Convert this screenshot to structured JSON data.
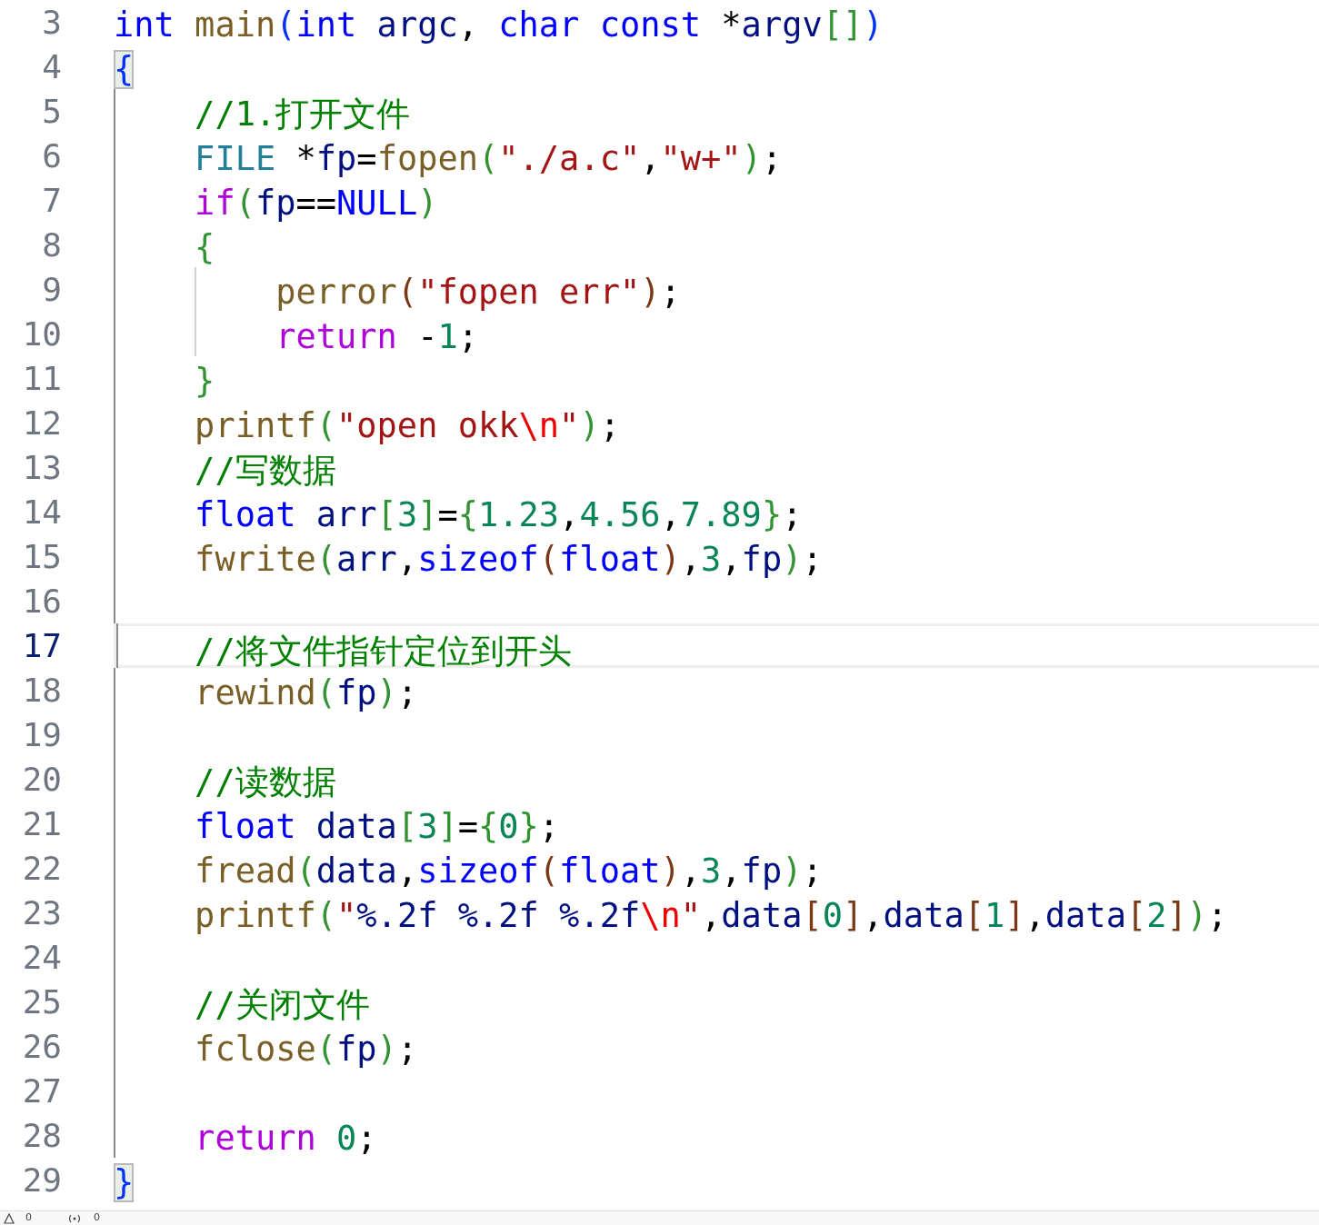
{
  "editor": {
    "lines": [
      {
        "number": "3",
        "current": false,
        "guide": false,
        "inner_guide": false,
        "tokens": [
          {
            "kind": "kw",
            "text": "int"
          },
          {
            "kind": "fn",
            "text": " main"
          },
          {
            "kind": "b1",
            "text": "("
          },
          {
            "kind": "kw",
            "text": "int"
          },
          {
            "kind": "var",
            "text": " argc"
          },
          {
            "kind": "op",
            "text": ", "
          },
          {
            "kind": "kw",
            "text": "char"
          },
          {
            "kind": "kw",
            "text": " const"
          },
          {
            "kind": "op",
            "text": " *"
          },
          {
            "kind": "var",
            "text": "argv"
          },
          {
            "kind": "b2",
            "text": "[]"
          },
          {
            "kind": "b1",
            "text": ")"
          }
        ]
      },
      {
        "number": "4",
        "current": false,
        "guide": false,
        "inner_guide": false,
        "tokens": [
          {
            "kind": "match",
            "text": "{"
          }
        ]
      },
      {
        "number": "5",
        "current": false,
        "guide": true,
        "inner_guide": false,
        "tokens": [
          {
            "kind": "cmt",
            "text": "    //1.打开文件"
          }
        ]
      },
      {
        "number": "6",
        "current": false,
        "guide": true,
        "inner_guide": false,
        "tokens": [
          {
            "kind": "type",
            "text": "    FILE"
          },
          {
            "kind": "op",
            "text": " *"
          },
          {
            "kind": "var",
            "text": "fp"
          },
          {
            "kind": "op",
            "text": "="
          },
          {
            "kind": "fn",
            "text": "fopen"
          },
          {
            "kind": "b2",
            "text": "("
          },
          {
            "kind": "str",
            "text": "\"./a.c\""
          },
          {
            "kind": "op",
            "text": ","
          },
          {
            "kind": "str",
            "text": "\"w+\""
          },
          {
            "kind": "b2",
            "text": ")"
          },
          {
            "kind": "op",
            "text": ";"
          }
        ]
      },
      {
        "number": "7",
        "current": false,
        "guide": true,
        "inner_guide": false,
        "tokens": [
          {
            "kind": "ctl",
            "text": "    if"
          },
          {
            "kind": "b2",
            "text": "("
          },
          {
            "kind": "var",
            "text": "fp"
          },
          {
            "kind": "op",
            "text": "=="
          },
          {
            "kind": "kw",
            "text": "NULL"
          },
          {
            "kind": "b2",
            "text": ")"
          }
        ]
      },
      {
        "number": "8",
        "current": false,
        "guide": true,
        "inner_guide": false,
        "tokens": [
          {
            "kind": "b2",
            "text": "    {"
          }
        ]
      },
      {
        "number": "9",
        "current": false,
        "guide": true,
        "inner_guide": true,
        "tokens": [
          {
            "kind": "fn",
            "text": "        perror"
          },
          {
            "kind": "b3",
            "text": "("
          },
          {
            "kind": "str",
            "text": "\"fopen err\""
          },
          {
            "kind": "b3",
            "text": ")"
          },
          {
            "kind": "op",
            "text": ";"
          }
        ]
      },
      {
        "number": "10",
        "current": false,
        "guide": true,
        "inner_guide": true,
        "tokens": [
          {
            "kind": "ctl",
            "text": "        return"
          },
          {
            "kind": "op",
            "text": " -"
          },
          {
            "kind": "num",
            "text": "1"
          },
          {
            "kind": "op",
            "text": ";"
          }
        ]
      },
      {
        "number": "11",
        "current": false,
        "guide": true,
        "inner_guide": false,
        "tokens": [
          {
            "kind": "b2",
            "text": "    }"
          }
        ]
      },
      {
        "number": "12",
        "current": false,
        "guide": true,
        "inner_guide": false,
        "tokens": [
          {
            "kind": "fn",
            "text": "    printf"
          },
          {
            "kind": "b2",
            "text": "("
          },
          {
            "kind": "str",
            "text": "\"open okk"
          },
          {
            "kind": "esc",
            "text": "\\n"
          },
          {
            "kind": "str",
            "text": "\""
          },
          {
            "kind": "b2",
            "text": ")"
          },
          {
            "kind": "op",
            "text": ";"
          }
        ]
      },
      {
        "number": "13",
        "current": false,
        "guide": true,
        "inner_guide": false,
        "tokens": [
          {
            "kind": "cmt",
            "text": "    //写数据"
          }
        ]
      },
      {
        "number": "14",
        "current": false,
        "guide": true,
        "inner_guide": false,
        "tokens": [
          {
            "kind": "kw",
            "text": "    float"
          },
          {
            "kind": "var",
            "text": " arr"
          },
          {
            "kind": "b2",
            "text": "["
          },
          {
            "kind": "num",
            "text": "3"
          },
          {
            "kind": "b2",
            "text": "]"
          },
          {
            "kind": "op",
            "text": "="
          },
          {
            "kind": "b2",
            "text": "{"
          },
          {
            "kind": "num",
            "text": "1.23"
          },
          {
            "kind": "op",
            "text": ","
          },
          {
            "kind": "num",
            "text": "4.56"
          },
          {
            "kind": "op",
            "text": ","
          },
          {
            "kind": "num",
            "text": "7.89"
          },
          {
            "kind": "b2",
            "text": "}"
          },
          {
            "kind": "op",
            "text": ";"
          }
        ]
      },
      {
        "number": "15",
        "current": false,
        "guide": true,
        "inner_guide": false,
        "tokens": [
          {
            "kind": "fn",
            "text": "    fwrite"
          },
          {
            "kind": "b2",
            "text": "("
          },
          {
            "kind": "var",
            "text": "arr"
          },
          {
            "kind": "op",
            "text": ","
          },
          {
            "kind": "kw",
            "text": "sizeof"
          },
          {
            "kind": "b3",
            "text": "("
          },
          {
            "kind": "kw",
            "text": "float"
          },
          {
            "kind": "b3",
            "text": ")"
          },
          {
            "kind": "op",
            "text": ","
          },
          {
            "kind": "num",
            "text": "3"
          },
          {
            "kind": "op",
            "text": ","
          },
          {
            "kind": "var",
            "text": "fp"
          },
          {
            "kind": "b2",
            "text": ")"
          },
          {
            "kind": "op",
            "text": ";"
          }
        ]
      },
      {
        "number": "16",
        "current": false,
        "guide": true,
        "inner_guide": false
      },
      {
        "number": "17",
        "current": true,
        "guide": true,
        "inner_guide": false,
        "tokens": [
          {
            "kind": "cmt",
            "text": "    //将文件指针定位到开头"
          }
        ]
      },
      {
        "number": "18",
        "current": false,
        "guide": true,
        "inner_guide": false,
        "tokens": [
          {
            "kind": "fn",
            "text": "    rewind"
          },
          {
            "kind": "b2",
            "text": "("
          },
          {
            "kind": "var",
            "text": "fp"
          },
          {
            "kind": "b2",
            "text": ")"
          },
          {
            "kind": "op",
            "text": ";"
          }
        ]
      },
      {
        "number": "19",
        "current": false,
        "guide": true,
        "inner_guide": false
      },
      {
        "number": "20",
        "current": false,
        "guide": true,
        "inner_guide": false,
        "tokens": [
          {
            "kind": "cmt",
            "text": "    //读数据"
          }
        ]
      },
      {
        "number": "21",
        "current": false,
        "guide": true,
        "inner_guide": false,
        "tokens": [
          {
            "kind": "kw",
            "text": "    float"
          },
          {
            "kind": "var",
            "text": " data"
          },
          {
            "kind": "b2",
            "text": "["
          },
          {
            "kind": "num",
            "text": "3"
          },
          {
            "kind": "b2",
            "text": "]"
          },
          {
            "kind": "op",
            "text": "="
          },
          {
            "kind": "b2",
            "text": "{"
          },
          {
            "kind": "num",
            "text": "0"
          },
          {
            "kind": "b2",
            "text": "}"
          },
          {
            "kind": "op",
            "text": ";"
          }
        ]
      },
      {
        "number": "22",
        "current": false,
        "guide": true,
        "inner_guide": false,
        "tokens": [
          {
            "kind": "fn",
            "text": "    fread"
          },
          {
            "kind": "b2",
            "text": "("
          },
          {
            "kind": "var",
            "text": "data"
          },
          {
            "kind": "op",
            "text": ","
          },
          {
            "kind": "kw",
            "text": "sizeof"
          },
          {
            "kind": "b3",
            "text": "("
          },
          {
            "kind": "kw",
            "text": "float"
          },
          {
            "kind": "b3",
            "text": ")"
          },
          {
            "kind": "op",
            "text": ","
          },
          {
            "kind": "num",
            "text": "3"
          },
          {
            "kind": "op",
            "text": ","
          },
          {
            "kind": "var",
            "text": "fp"
          },
          {
            "kind": "b2",
            "text": ")"
          },
          {
            "kind": "op",
            "text": ";"
          }
        ]
      },
      {
        "number": "23",
        "current": false,
        "guide": true,
        "inner_guide": false,
        "tokens": [
          {
            "kind": "fn",
            "text": "    printf"
          },
          {
            "kind": "b2",
            "text": "("
          },
          {
            "kind": "str",
            "text": "\""
          },
          {
            "kind": "fmt",
            "text": "%.2f"
          },
          {
            "kind": "fmt",
            "text": " %.2f"
          },
          {
            "kind": "fmt",
            "text": " %.2f"
          },
          {
            "kind": "esc",
            "text": "\\n"
          },
          {
            "kind": "str",
            "text": "\""
          },
          {
            "kind": "op",
            "text": ","
          },
          {
            "kind": "var",
            "text": "data"
          },
          {
            "kind": "b3",
            "text": "["
          },
          {
            "kind": "num",
            "text": "0"
          },
          {
            "kind": "b3",
            "text": "]"
          },
          {
            "kind": "op",
            "text": ","
          },
          {
            "kind": "var",
            "text": "data"
          },
          {
            "kind": "b3",
            "text": "["
          },
          {
            "kind": "num",
            "text": "1"
          },
          {
            "kind": "b3",
            "text": "]"
          },
          {
            "kind": "op",
            "text": ","
          },
          {
            "kind": "var",
            "text": "data"
          },
          {
            "kind": "b3",
            "text": "["
          },
          {
            "kind": "num",
            "text": "2"
          },
          {
            "kind": "b3",
            "text": "]"
          },
          {
            "kind": "b2",
            "text": ")"
          },
          {
            "kind": "op",
            "text": ";"
          }
        ]
      },
      {
        "number": "24",
        "current": false,
        "guide": true,
        "inner_guide": false
      },
      {
        "number": "25",
        "current": false,
        "guide": true,
        "inner_guide": false,
        "tokens": [
          {
            "kind": "cmt",
            "text": "    //关闭文件"
          }
        ]
      },
      {
        "number": "26",
        "current": false,
        "guide": true,
        "inner_guide": false,
        "tokens": [
          {
            "kind": "fn",
            "text": "    fclose"
          },
          {
            "kind": "b2",
            "text": "("
          },
          {
            "kind": "var",
            "text": "fp"
          },
          {
            "kind": "b2",
            "text": ")"
          },
          {
            "kind": "op",
            "text": ";"
          }
        ]
      },
      {
        "number": "27",
        "current": false,
        "guide": true,
        "inner_guide": false
      },
      {
        "number": "28",
        "current": false,
        "guide": true,
        "inner_guide": false,
        "tokens": [
          {
            "kind": "ctl",
            "text": "    return"
          },
          {
            "kind": "num",
            "text": " 0"
          },
          {
            "kind": "op",
            "text": ";"
          }
        ]
      },
      {
        "number": "29",
        "current": false,
        "guide": false,
        "inner_guide": false,
        "tokens": [
          {
            "kind": "match",
            "text": "}"
          }
        ]
      }
    ]
  },
  "status_bar": {
    "items": [
      {
        "kind": "warnings",
        "text": "0"
      },
      {
        "kind": "ports",
        "text": "0"
      }
    ]
  }
}
